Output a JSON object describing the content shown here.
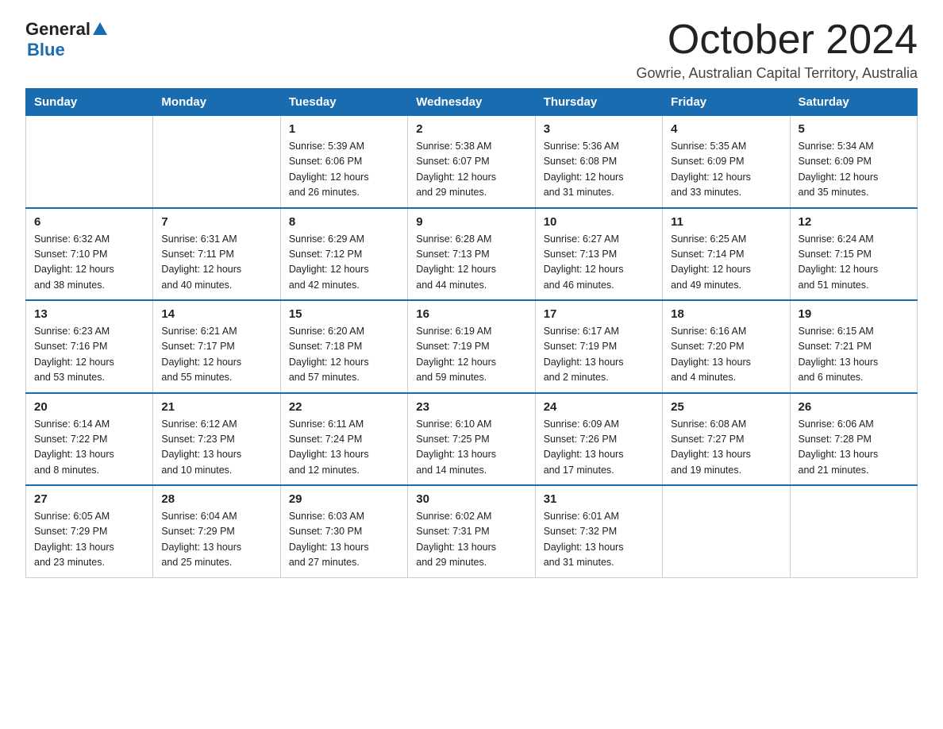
{
  "header": {
    "logo_general": "General",
    "logo_blue": "Blue",
    "month_title": "October 2024",
    "subtitle": "Gowrie, Australian Capital Territory, Australia"
  },
  "days_of_week": [
    "Sunday",
    "Monday",
    "Tuesday",
    "Wednesday",
    "Thursday",
    "Friday",
    "Saturday"
  ],
  "weeks": [
    [
      {
        "day": "",
        "info": ""
      },
      {
        "day": "",
        "info": ""
      },
      {
        "day": "1",
        "info": "Sunrise: 5:39 AM\nSunset: 6:06 PM\nDaylight: 12 hours\nand 26 minutes."
      },
      {
        "day": "2",
        "info": "Sunrise: 5:38 AM\nSunset: 6:07 PM\nDaylight: 12 hours\nand 29 minutes."
      },
      {
        "day": "3",
        "info": "Sunrise: 5:36 AM\nSunset: 6:08 PM\nDaylight: 12 hours\nand 31 minutes."
      },
      {
        "day": "4",
        "info": "Sunrise: 5:35 AM\nSunset: 6:09 PM\nDaylight: 12 hours\nand 33 minutes."
      },
      {
        "day": "5",
        "info": "Sunrise: 5:34 AM\nSunset: 6:09 PM\nDaylight: 12 hours\nand 35 minutes."
      }
    ],
    [
      {
        "day": "6",
        "info": "Sunrise: 6:32 AM\nSunset: 7:10 PM\nDaylight: 12 hours\nand 38 minutes."
      },
      {
        "day": "7",
        "info": "Sunrise: 6:31 AM\nSunset: 7:11 PM\nDaylight: 12 hours\nand 40 minutes."
      },
      {
        "day": "8",
        "info": "Sunrise: 6:29 AM\nSunset: 7:12 PM\nDaylight: 12 hours\nand 42 minutes."
      },
      {
        "day": "9",
        "info": "Sunrise: 6:28 AM\nSunset: 7:13 PM\nDaylight: 12 hours\nand 44 minutes."
      },
      {
        "day": "10",
        "info": "Sunrise: 6:27 AM\nSunset: 7:13 PM\nDaylight: 12 hours\nand 46 minutes."
      },
      {
        "day": "11",
        "info": "Sunrise: 6:25 AM\nSunset: 7:14 PM\nDaylight: 12 hours\nand 49 minutes."
      },
      {
        "day": "12",
        "info": "Sunrise: 6:24 AM\nSunset: 7:15 PM\nDaylight: 12 hours\nand 51 minutes."
      }
    ],
    [
      {
        "day": "13",
        "info": "Sunrise: 6:23 AM\nSunset: 7:16 PM\nDaylight: 12 hours\nand 53 minutes."
      },
      {
        "day": "14",
        "info": "Sunrise: 6:21 AM\nSunset: 7:17 PM\nDaylight: 12 hours\nand 55 minutes."
      },
      {
        "day": "15",
        "info": "Sunrise: 6:20 AM\nSunset: 7:18 PM\nDaylight: 12 hours\nand 57 minutes."
      },
      {
        "day": "16",
        "info": "Sunrise: 6:19 AM\nSunset: 7:19 PM\nDaylight: 12 hours\nand 59 minutes."
      },
      {
        "day": "17",
        "info": "Sunrise: 6:17 AM\nSunset: 7:19 PM\nDaylight: 13 hours\nand 2 minutes."
      },
      {
        "day": "18",
        "info": "Sunrise: 6:16 AM\nSunset: 7:20 PM\nDaylight: 13 hours\nand 4 minutes."
      },
      {
        "day": "19",
        "info": "Sunrise: 6:15 AM\nSunset: 7:21 PM\nDaylight: 13 hours\nand 6 minutes."
      }
    ],
    [
      {
        "day": "20",
        "info": "Sunrise: 6:14 AM\nSunset: 7:22 PM\nDaylight: 13 hours\nand 8 minutes."
      },
      {
        "day": "21",
        "info": "Sunrise: 6:12 AM\nSunset: 7:23 PM\nDaylight: 13 hours\nand 10 minutes."
      },
      {
        "day": "22",
        "info": "Sunrise: 6:11 AM\nSunset: 7:24 PM\nDaylight: 13 hours\nand 12 minutes."
      },
      {
        "day": "23",
        "info": "Sunrise: 6:10 AM\nSunset: 7:25 PM\nDaylight: 13 hours\nand 14 minutes."
      },
      {
        "day": "24",
        "info": "Sunrise: 6:09 AM\nSunset: 7:26 PM\nDaylight: 13 hours\nand 17 minutes."
      },
      {
        "day": "25",
        "info": "Sunrise: 6:08 AM\nSunset: 7:27 PM\nDaylight: 13 hours\nand 19 minutes."
      },
      {
        "day": "26",
        "info": "Sunrise: 6:06 AM\nSunset: 7:28 PM\nDaylight: 13 hours\nand 21 minutes."
      }
    ],
    [
      {
        "day": "27",
        "info": "Sunrise: 6:05 AM\nSunset: 7:29 PM\nDaylight: 13 hours\nand 23 minutes."
      },
      {
        "day": "28",
        "info": "Sunrise: 6:04 AM\nSunset: 7:29 PM\nDaylight: 13 hours\nand 25 minutes."
      },
      {
        "day": "29",
        "info": "Sunrise: 6:03 AM\nSunset: 7:30 PM\nDaylight: 13 hours\nand 27 minutes."
      },
      {
        "day": "30",
        "info": "Sunrise: 6:02 AM\nSunset: 7:31 PM\nDaylight: 13 hours\nand 29 minutes."
      },
      {
        "day": "31",
        "info": "Sunrise: 6:01 AM\nSunset: 7:32 PM\nDaylight: 13 hours\nand 31 minutes."
      },
      {
        "day": "",
        "info": ""
      },
      {
        "day": "",
        "info": ""
      }
    ]
  ]
}
